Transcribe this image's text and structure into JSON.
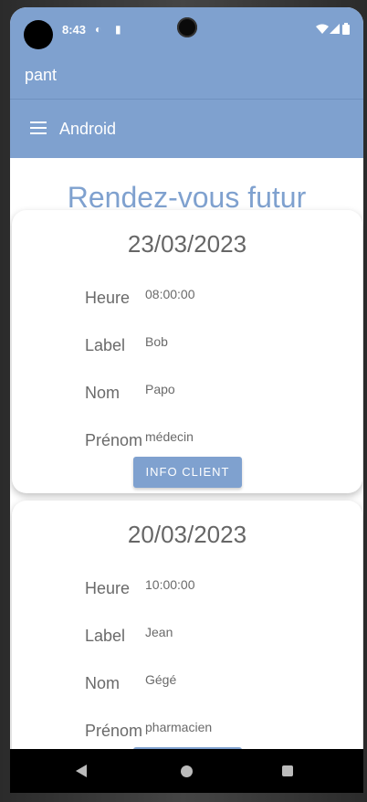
{
  "status": {
    "time": "8:43"
  },
  "app": {
    "title": "pant"
  },
  "toolbar": {
    "title": "Android"
  },
  "page": {
    "title": "Rendez-vous futur"
  },
  "labels": {
    "hour": "Heure",
    "label": "Label",
    "name": "Nom",
    "firstname": "Prénom",
    "button": "INFO CLIENT"
  },
  "appointments": [
    {
      "date": "23/03/2023",
      "hour": "08:00:00",
      "label": "Bob",
      "name": "Papo",
      "firstname": "médecin"
    },
    {
      "date": "20/03/2023",
      "hour": "10:00:00",
      "label": "Jean",
      "name": "Gégé",
      "firstname": "pharmacien"
    }
  ],
  "icons": [
    "wifi-icon",
    "signal-icon",
    "battery-icon",
    "menu-icon",
    "back-icon",
    "home-icon",
    "recents-icon"
  ]
}
